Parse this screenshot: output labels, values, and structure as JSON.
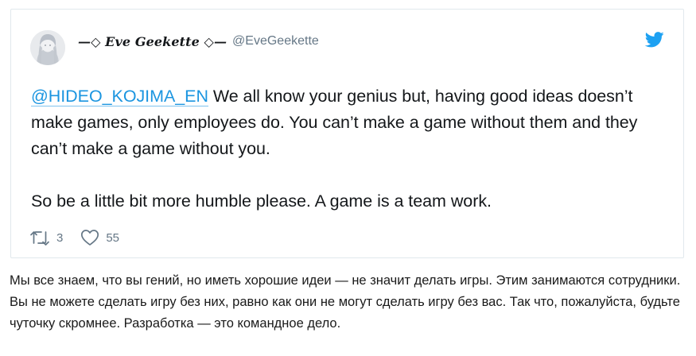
{
  "tweet": {
    "author": {
      "display_name": "—◇ Eve Geekette ◇—",
      "handle": "@EveGeekette",
      "avatar_icon": "avatar-icon"
    },
    "logo_icon": "twitter-bird-icon",
    "body": {
      "mention": "@HIDEO_KOJIMA_EN",
      "first_paragraph_rest": " We all know your genius but, having good ideas doesn’t make games, only employees do. You can’t make a game without them and they can’t make a game without you.",
      "second_paragraph": "So be a little bit more humble please. A game is a team work."
    },
    "actions": {
      "retweet_count": "3",
      "like_count": "55"
    }
  },
  "translation": {
    "text": "Мы все знаем, что вы гений, но иметь хорошие идеи — не значит делать игры. Этим занимаются сотрудники. Вы не можете сделать игру без них, равно как они не могут сделать игру без вас. Так что, пожалуйста, будьте чуточку скромнее. Разработка — это командное дело."
  },
  "colors": {
    "link": "#1b95e0",
    "text": "#14171a",
    "secondary": "#657786",
    "border": "#e1e8ed",
    "twitter_blue": "#1da1f2"
  }
}
